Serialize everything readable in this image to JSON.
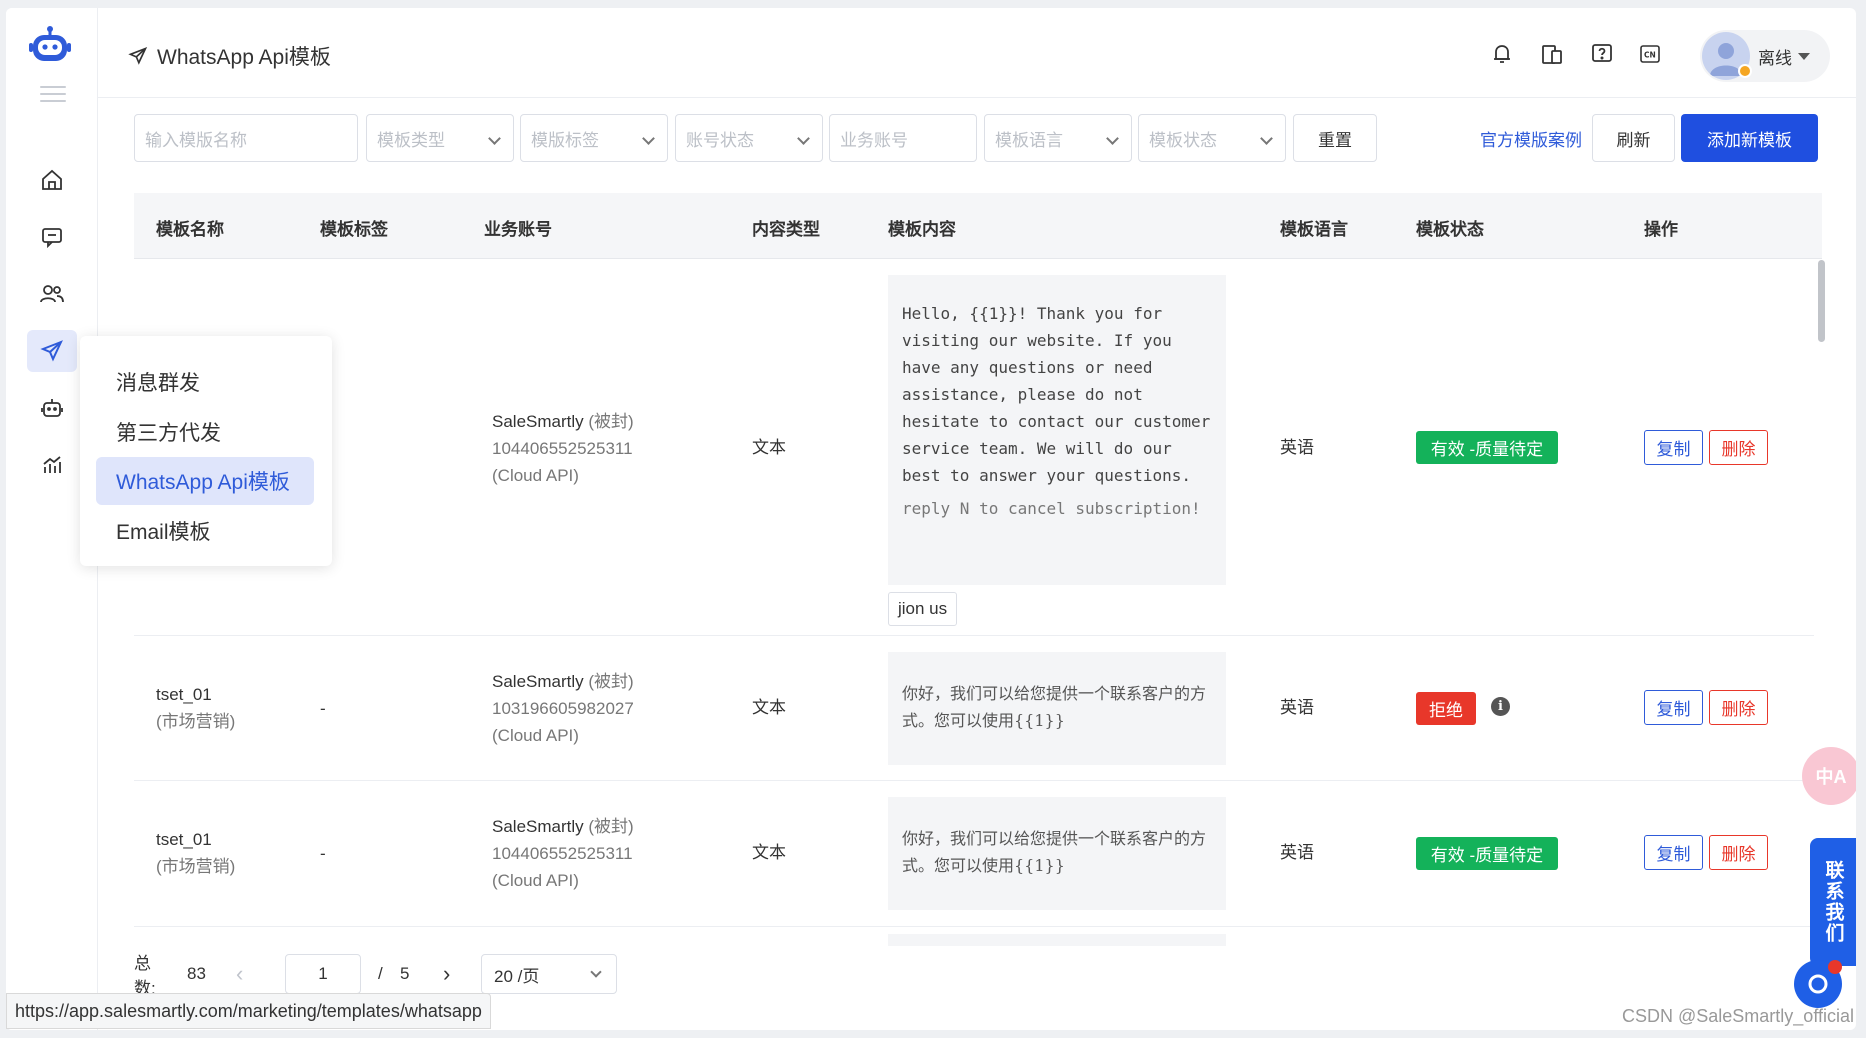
{
  "page_title": "WhatsApp Api模板",
  "user": {
    "status_label": "离线"
  },
  "topbar_icons": [
    "bell-icon",
    "devices-icon",
    "help-icon",
    "language-cn-icon"
  ],
  "nav": [
    "home-icon",
    "chat-icon",
    "contacts-icon",
    "send-icon",
    "bot-icon",
    "analytics-icon"
  ],
  "submenu": {
    "items": [
      "消息群发",
      "第三方代发",
      "WhatsApp Api模板",
      "Email模板"
    ],
    "selected_index": 2
  },
  "filters": {
    "name_placeholder": "输入模版名称",
    "type_placeholder": "模板类型",
    "tag_placeholder": "模版标签",
    "account_status_placeholder": "账号状态",
    "account_placeholder": "业务账号",
    "language_placeholder": "模板语言",
    "template_status_placeholder": "模板状态",
    "reset_label": "重置"
  },
  "actions": {
    "examples_label": "官方模版案例",
    "refresh_label": "刷新",
    "add_label": "添加新模板"
  },
  "table": {
    "headers": [
      "模板名称",
      "模板标签",
      "业务账号",
      "内容类型",
      "模板内容",
      "模板语言",
      "模板状态",
      "操作"
    ],
    "rows": [
      {
        "name": "",
        "name_sub": "",
        "tag": "-",
        "account_name": "SaleSmartly",
        "account_flag": "(被封)",
        "account_id": "104406552525311",
        "account_api": "(Cloud API)",
        "content_type": "文本",
        "content": "Hello, {{1}}! Thank you for visiting our website. If you have any questions or need assistance, please do not hesitate to contact our customer service team. We will do our best to answer your questions.",
        "content_footer": "reply N to cancel subscription!",
        "button": "jion us",
        "language": "英语",
        "status": "有效 -质量待定",
        "status_color": "#14b25a",
        "copy_label": "复制",
        "delete_label": "删除"
      },
      {
        "name": "tset_01",
        "name_sub": "(市场营销)",
        "tag": "-",
        "account_name": "SaleSmartly",
        "account_flag": "(被封)",
        "account_id": "103196605982027",
        "account_api": "(Cloud API)",
        "content_type": "文本",
        "content": "你好，我们可以给您提供一个联系客户的方式。您可以使用{{1}}",
        "language": "英语",
        "status": "拒绝",
        "status_color": "#e8372a",
        "copy_label": "复制",
        "delete_label": "删除"
      },
      {
        "name": "tset_01",
        "name_sub": "(市场营销)",
        "tag": "-",
        "account_name": "SaleSmartly",
        "account_flag": "(被封)",
        "account_id": "104406552525311",
        "account_api": "(Cloud API)",
        "content_type": "文本",
        "content": "你好，我们可以给您提供一个联系客户的方式。您可以使用{{1}}",
        "language": "英语",
        "status": "有效 -质量待定",
        "status_color": "#14b25a",
        "copy_label": "复制",
        "delete_label": "删除"
      }
    ]
  },
  "pagination": {
    "total_label": "总数:",
    "total": "83",
    "current_page": "1",
    "separator": "/",
    "total_pages": "5",
    "page_size": "20 /页"
  },
  "statusbar_url": "https://app.salesmartly.com/marketing/templates/whatsapp",
  "watermark": "CSDN @SaleSmartly_official",
  "float": {
    "translate_label": "中A",
    "contact_label": "联系我们"
  },
  "colors": {
    "primary": "#1f4fe0",
    "link": "#2f5bd9",
    "success": "#14b25a",
    "danger": "#e8372a"
  }
}
